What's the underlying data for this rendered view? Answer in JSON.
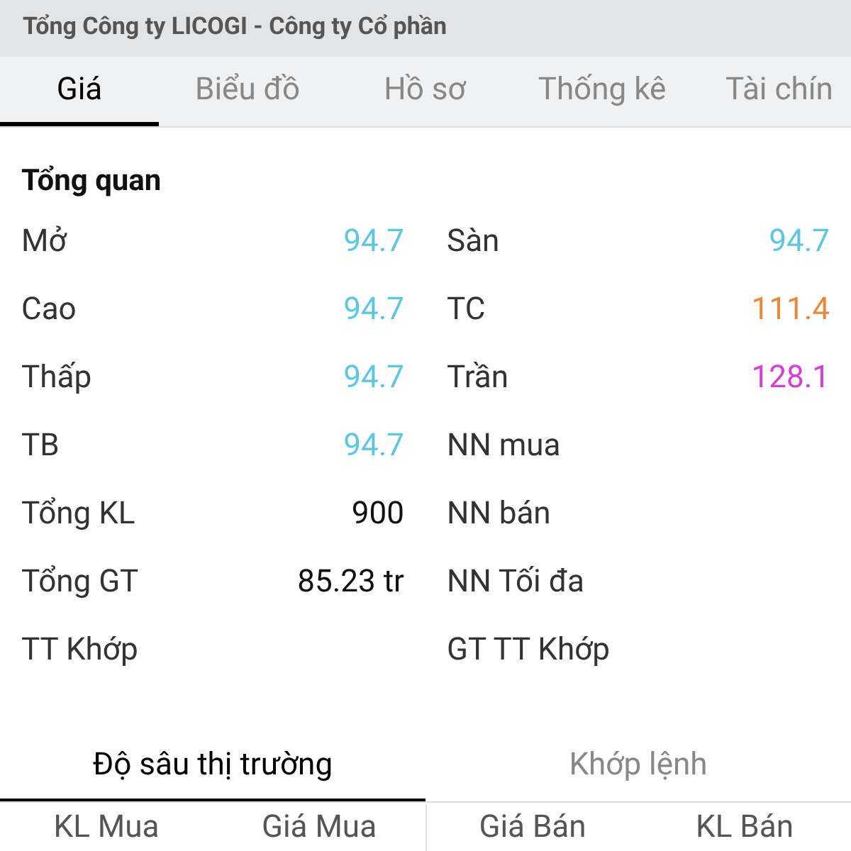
{
  "title": "Tổng Công ty LICOGI - Công ty Cổ phần",
  "tabs": [
    {
      "label": "Giá",
      "selected": true
    },
    {
      "label": "Biểu đồ",
      "selected": false
    },
    {
      "label": "Hồ sơ",
      "selected": false
    },
    {
      "label": "Thống kê",
      "selected": false
    },
    {
      "label": "Tài chín",
      "selected": false
    }
  ],
  "overview": {
    "heading": "Tổng quan",
    "rows": [
      [
        {
          "label": "Mở",
          "value": "94.7",
          "color": "#5bc8e0"
        },
        {
          "label": "Sàn",
          "value": "94.7",
          "color": "#5bc8e0"
        }
      ],
      [
        {
          "label": "Cao",
          "value": "94.7",
          "color": "#5bc8e0"
        },
        {
          "label": "TC",
          "value": "111.4",
          "color": "#e8893a"
        }
      ],
      [
        {
          "label": "Thấp",
          "value": "94.7",
          "color": "#5bc8e0"
        },
        {
          "label": "Trần",
          "value": "128.1",
          "color": "#d63fd6"
        }
      ],
      [
        {
          "label": "TB",
          "value": "94.7",
          "color": "#5bc8e0"
        },
        {
          "label": "NN mua"
        }
      ],
      [
        {
          "label": "Tổng KL",
          "value": "900",
          "color": "#111111"
        },
        {
          "label": "NN bán"
        }
      ],
      [
        {
          "label": "Tổng GT",
          "value": "85.23 tr",
          "color": "#111111"
        },
        {
          "label": "NN Tối đa"
        }
      ],
      [
        {
          "label": "TT Khớp"
        },
        {
          "label": "GT TT Khớp"
        }
      ]
    ]
  },
  "sub_tabs": [
    {
      "label": "Độ sâu thị trường",
      "selected": true
    },
    {
      "label": "Khớp lệnh",
      "selected": false
    }
  ],
  "depth_columns": [
    "KL Mua",
    "Giá Mua",
    "Giá Bán",
    "KL Bán"
  ]
}
